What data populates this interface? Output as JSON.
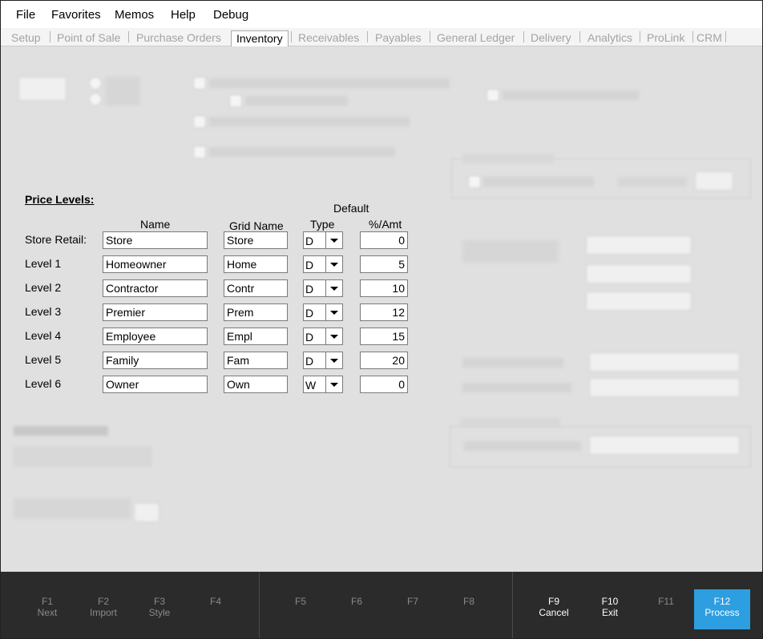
{
  "menu": [
    "File",
    "Favorites",
    "Memos",
    "Help",
    "Debug"
  ],
  "tabs": [
    "Setup",
    "Point of Sale",
    "Purchase Orders",
    "Inventory",
    "Receivables",
    "Payables",
    "General Ledger",
    "Delivery",
    "Analytics",
    "ProLink",
    "CRM"
  ],
  "active_tab": "Inventory",
  "price_levels": {
    "title": "Price Levels:",
    "header_default": "Default",
    "header_name": "Name",
    "header_grid": "Grid Name",
    "header_type": "Type",
    "header_amt": "%/Amt",
    "rows": [
      {
        "label": "Store Retail:",
        "name": "Store",
        "grid": "Store",
        "type": "D",
        "amt": "0"
      },
      {
        "label": "Level 1",
        "name": "Homeowner",
        "grid": "Home",
        "type": "D",
        "amt": "5"
      },
      {
        "label": "Level 2",
        "name": "Contractor",
        "grid": "Contr",
        "type": "D",
        "amt": "10"
      },
      {
        "label": "Level 3",
        "name": "Premier",
        "grid": "Prem",
        "type": "D",
        "amt": "12"
      },
      {
        "label": "Level 4",
        "name": "Employee",
        "grid": "Empl",
        "type": "D",
        "amt": "15"
      },
      {
        "label": "Level 5",
        "name": "Family",
        "grid": "Fam",
        "type": "D",
        "amt": "20"
      },
      {
        "label": "Level 6",
        "name": "Owner",
        "grid": "Own",
        "type": "W",
        "amt": "0"
      }
    ]
  },
  "fkeys": [
    {
      "key": "F1",
      "label": "Next"
    },
    {
      "key": "F2",
      "label": "Import"
    },
    {
      "key": "F3",
      "label": "Style"
    },
    {
      "key": "F4",
      "label": ""
    },
    {
      "key": "F5",
      "label": ""
    },
    {
      "key": "F6",
      "label": ""
    },
    {
      "key": "F7",
      "label": ""
    },
    {
      "key": "F8",
      "label": ""
    },
    {
      "key": "F9",
      "label": "Cancel"
    },
    {
      "key": "F10",
      "label": "Exit"
    },
    {
      "key": "F11",
      "label": ""
    },
    {
      "key": "F12",
      "label": "Process"
    }
  ],
  "colors": {
    "fkey_bar": "#2b2b2b",
    "primary": "#2d9ee0",
    "content_bg": "#e0e0e0"
  }
}
